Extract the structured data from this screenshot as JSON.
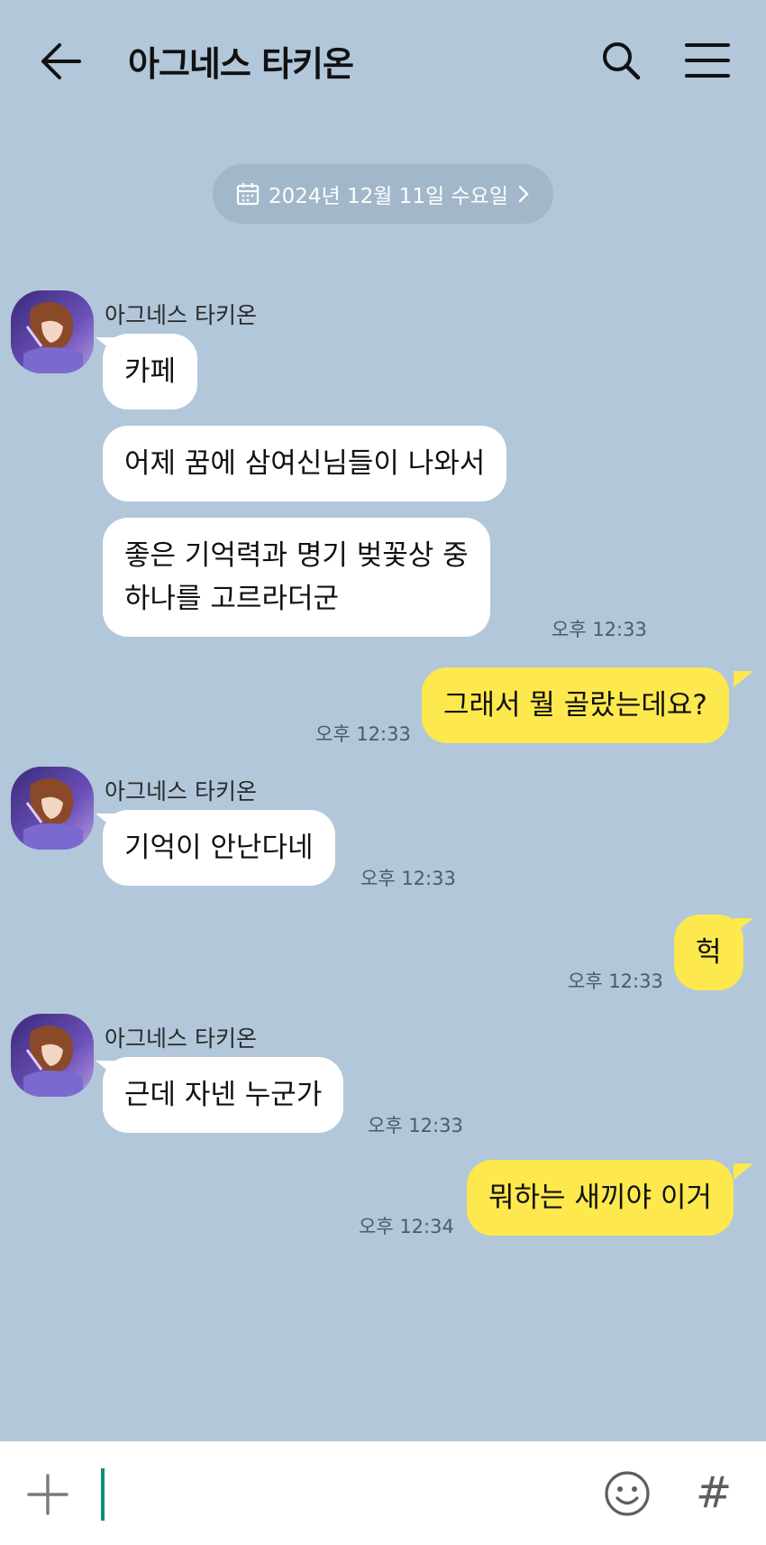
{
  "header": {
    "title": "아그네스 타키온",
    "back_icon": "back-arrow-icon",
    "search_icon": "search-icon",
    "menu_icon": "menu-icon"
  },
  "date_divider": {
    "label": "2024년 12월 11일 수요일",
    "icon": "calendar-icon",
    "chevron": "chevron-right-icon"
  },
  "messages": [
    {
      "sender": "아그네스 타키온",
      "text": "카페"
    },
    {
      "text": "어제 꿈에 삼여신님들이 나와서"
    },
    {
      "line1": "좋은 기억력과 명기 벚꽃상 중",
      "line2": "하나를 고르라더군",
      "time": "오후 12:33"
    },
    {
      "text": "그래서 뭘 골랐는데요?",
      "time": "오후 12:33"
    },
    {
      "sender": "아그네스 타키온",
      "text": "기억이 안난다네",
      "time": "오후 12:33"
    },
    {
      "text": "헉",
      "time": "오후 12:33"
    },
    {
      "sender": "아그네스 타키온",
      "text": "근데 자넨 누군가",
      "time": "오후 12:33"
    },
    {
      "text": "뭐하는 새끼야 이거",
      "time": "오후 12:34"
    }
  ],
  "input_bar": {
    "placeholder": "",
    "plus_icon": "plus-icon",
    "emoji_icon": "emoji-icon",
    "hash_label": "#"
  },
  "colors": {
    "background": "#b2c7da",
    "outgoing_bubble": "#fde84e",
    "incoming_bubble": "#ffffff",
    "caret": "#0e8c7e"
  }
}
